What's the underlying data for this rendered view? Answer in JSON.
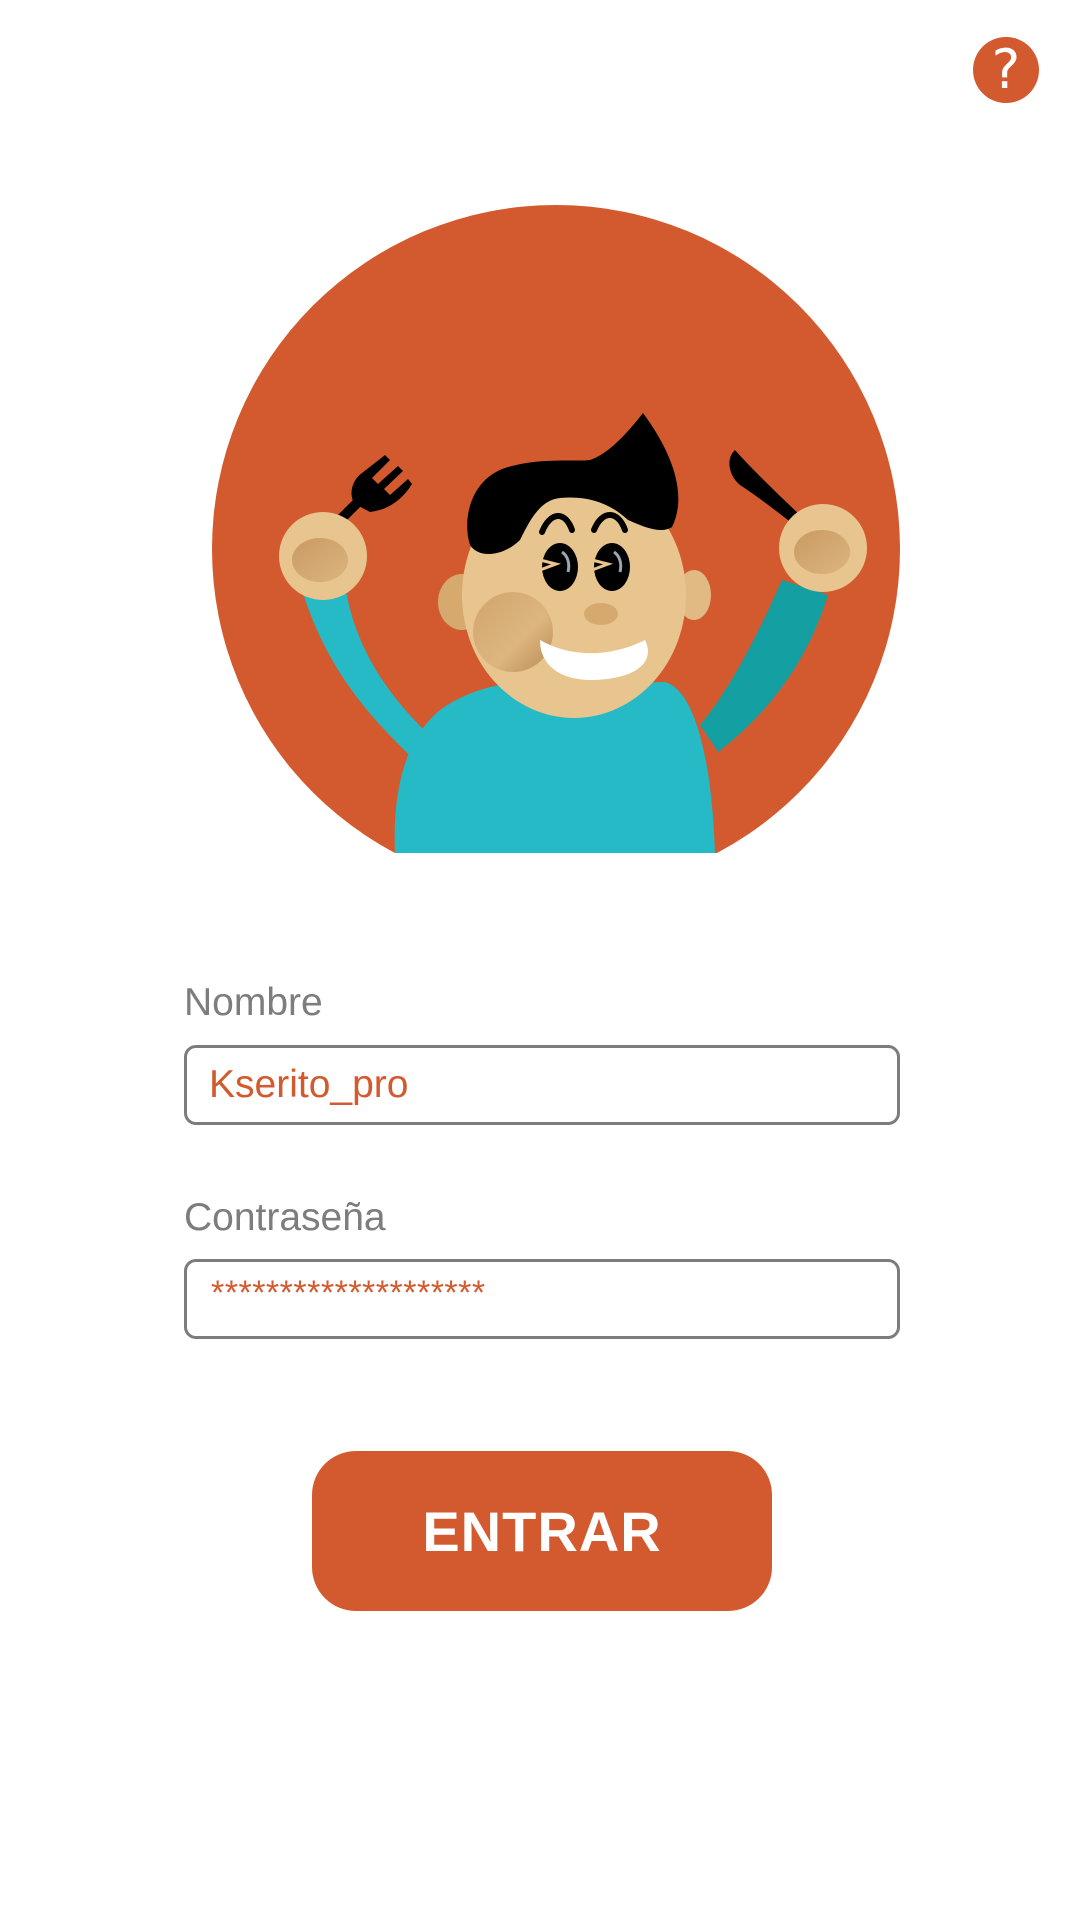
{
  "help": {
    "glyph": "?",
    "icon": "question-mark-icon"
  },
  "colors": {
    "accent": "#d35a2e",
    "field_border": "#7c7c7c",
    "label": "#7d7d7d",
    "shirt": "#26b9c6",
    "skin": "#e8c48f",
    "hair": "#000000"
  },
  "mascot": {
    "icon": "boy-with-fork-and-knife-illustration"
  },
  "form": {
    "name": {
      "label": "Nombre",
      "value": "Kserito_pro"
    },
    "password": {
      "label": "Contraseña",
      "masked_value": "********************"
    },
    "submit_label": "ENTRAR"
  }
}
